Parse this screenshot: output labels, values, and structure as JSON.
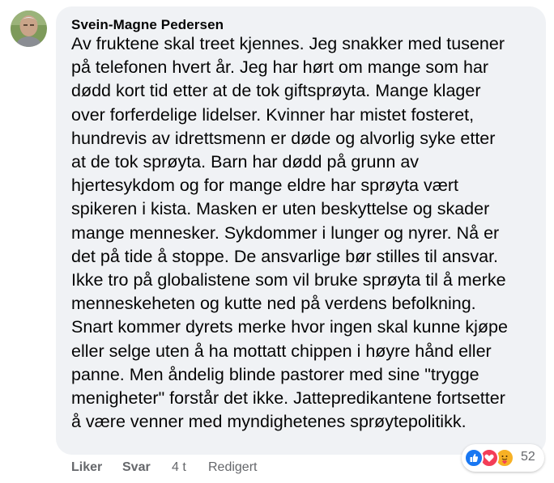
{
  "comment": {
    "author": "Svein-Magne Pedersen",
    "lines": [
      "Av fruktene skal treet kjennes. Jeg snakker med tusener",
      "på telefonen hvert år. Jeg har hørt om mange som har",
      "dødd kort tid etter at de tok giftsprøyta. Mange klager",
      "over forferdelige lidelser. Kvinner har mistet fosteret,",
      "hundrevis av idrettsmenn er døde og alvorlig syke etter",
      "at de tok sprøyta. Barn har dødd på grunn av",
      "hjertesykdom og for mange eldre har sprøyta vært",
      "spikeren i kista. Masken er uten beskyttelse og skader",
      "mange mennesker. Sykdommer i lunger og nyrer. Nå er",
      "det på tide å stoppe. De ansvarlige bør stilles til ansvar.",
      "Ikke tro på globalistene som vil bruke sprøyta til å merke",
      "menneskeheten og kutte ned på verdens befolkning.",
      "Snart kommer dyrets merke hvor ingen skal kunne kjøpe",
      "eller selge uten å ha mottatt chippen i høyre hånd eller",
      "panne. Men åndelig blinde pastorer med sine \"trygge",
      "menigheter\" forstår det ikke. Jattepredikantene fortsetter",
      "å være venner med myndighetenes sprøytepolitikk."
    ]
  },
  "actions": {
    "like_label": "Liker",
    "reply_label": "Svar",
    "time": "4 t",
    "edited": "Redigert"
  },
  "reactions": {
    "icons": [
      "like-icon",
      "love-icon",
      "care-icon"
    ],
    "count": "52"
  },
  "colors": {
    "bubble_bg": "#f0f2f5",
    "text": "#050505",
    "secondary_text": "#65676b",
    "like_blue": "#1877f2",
    "love_red": "#f33e58",
    "care_yellow": "#f7b125"
  }
}
